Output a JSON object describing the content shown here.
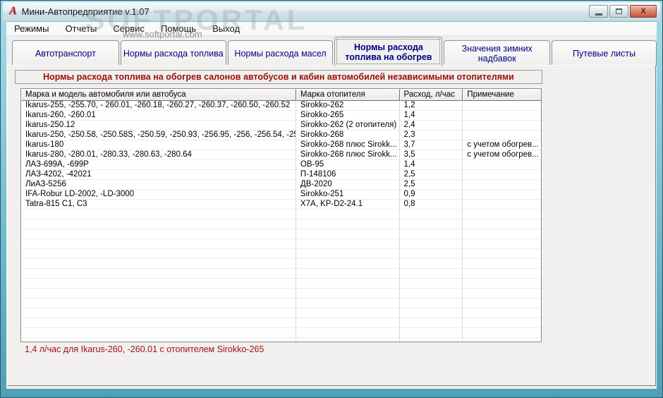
{
  "window": {
    "title": "Мини-Автопредприятие v.1.07",
    "icon_glyph": "A",
    "close_glyph": "X"
  },
  "menu": {
    "items": [
      {
        "name": "modes",
        "label": "Режимы"
      },
      {
        "name": "reports",
        "label": "Отчеты"
      },
      {
        "name": "service",
        "label": "Сервис"
      },
      {
        "name": "help",
        "label": "Помощь"
      },
      {
        "name": "exit",
        "label": "Выход"
      }
    ]
  },
  "watermark": {
    "big": "SOFTPORTAL",
    "small": "www.softportal.com"
  },
  "tabs": [
    {
      "name": "autotransport",
      "label": "Автотранспорт",
      "active": false
    },
    {
      "name": "fuel-norms",
      "label": "Нормы расхода  топлива",
      "active": false
    },
    {
      "name": "oil-norms",
      "label": "Нормы расхода  масел",
      "active": false
    },
    {
      "name": "heating-fuel-norms",
      "label": "Нормы расхода\nтоплива на обогрев",
      "active": true
    },
    {
      "name": "winter-allowances",
      "label": "Значения зимних надбавок",
      "active": false
    },
    {
      "name": "waybills",
      "label": "Путевые листы",
      "active": false
    }
  ],
  "banner": "Нормы расхода топлива на обогрев салонов автобусов и кабин автомобилей независимыми отопителями",
  "table": {
    "columns": [
      "Марка и модель автомобиля или автобуса",
      "Марка отопителя",
      "Расход, л/час",
      "Примечание"
    ],
    "rows": [
      [
        "Ikarus-255, -255.70, - 260.01, -260.18, -260.27, -260.37, -260.50, -260.52",
        "Sirokko-262",
        "1,2",
        ""
      ],
      [
        "Ikarus-260, -260.01",
        "Sirokko-265",
        "1,4",
        ""
      ],
      [
        "Ikarus-250.12",
        "Sirokko-262 (2 отопителя)",
        "2,4",
        ""
      ],
      [
        "Ikarus-250, -250.58, -250.58S, -250.59, -250.93, -256.95, -256, -256.54, -256.5...",
        "Sirokko-268",
        "2,3",
        ""
      ],
      [
        "Ikarus-180",
        "Sirokko-268 плюс Sirokk...",
        "3,7",
        "с учетом обогрев..."
      ],
      [
        "Ikarus-280, -280.01, -280.33, -280.63, -280.64",
        "Sirokko-268 плюс Sirokk...",
        "3,5",
        "с учетом обогрев..."
      ],
      [
        "ЛАЗ-699А, -699Р",
        "ОВ-95",
        "1,4",
        ""
      ],
      [
        "ЛАЗ-4202, -42021",
        "П-148106",
        "2,5",
        ""
      ],
      [
        "ЛиАЗ-5256",
        "ДВ-2020",
        "2,5",
        ""
      ],
      [
        "IFA-Robur LD-2002, -LD-3000",
        "Sirokko-251",
        "0,9",
        ""
      ],
      [
        "Tatra-815 C1, C3",
        "X7A, KP-D2-24.1",
        "0,8",
        ""
      ]
    ],
    "empty_rows": 14
  },
  "status": "1,4 л/час для Ikarus-260, -260.01 с отопителем Sirokko-265",
  "colors": {
    "frame": "#4f9fb6",
    "tab_text": "#000080",
    "banner_text": "#9b0d0d",
    "status_text": "#a11111",
    "close_button": "#c25540"
  }
}
